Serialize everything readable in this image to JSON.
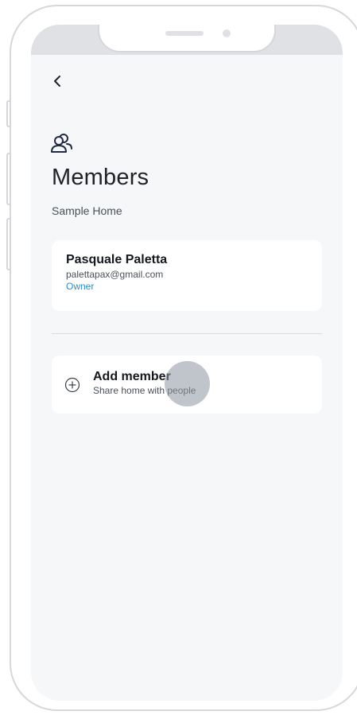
{
  "header": {
    "back_icon": "chevron-left-icon",
    "section_icon": "people-icon",
    "title": "Members",
    "subtitle": "Sample Home"
  },
  "members": [
    {
      "name": "Pasquale Paletta",
      "email": "palettapax@gmail.com",
      "role": "Owner"
    }
  ],
  "add_member": {
    "icon": "plus-circle-icon",
    "label": "Add member",
    "sublabel": "Share home with people"
  },
  "colors": {
    "accent": "#2a8fc6",
    "screen_background": "#f6f7f8",
    "card_background": "#ffffff",
    "text_primary": "#15191e"
  }
}
